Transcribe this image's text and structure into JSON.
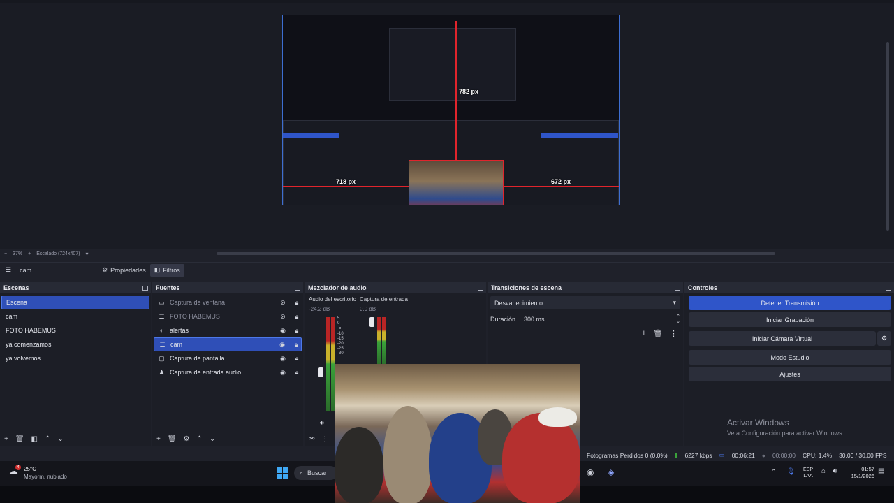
{
  "preview": {
    "guides": {
      "top": "782 px",
      "left": "718 px",
      "right": "672 px"
    },
    "status_zoom_minus": "−",
    "status_zoom_value": "37%",
    "status_zoom_plus": "+",
    "status_scale": "Escalado (724x407)"
  },
  "context_bar": {
    "source_name": "cam",
    "properties_label": "Propiedades",
    "filters_label": "Filtros"
  },
  "scenes": {
    "title": "Escenas",
    "items": [
      "Escena",
      "cam",
      "FOTO HABEMUS",
      "ya comenzamos",
      "ya volvemos"
    ],
    "selected_index": 0
  },
  "sources": {
    "title": "Fuentes",
    "items": [
      {
        "label": "Captura de ventana",
        "icon": "window-icon",
        "visible": false
      },
      {
        "label": "FOTO HABEMUS",
        "icon": "list-icon",
        "visible": false
      },
      {
        "label": "alertas",
        "icon": "globe-icon",
        "visible": true
      },
      {
        "label": "cam",
        "icon": "list-icon",
        "visible": true
      },
      {
        "label": "Captura de pantalla",
        "icon": "monitor-icon",
        "visible": true
      },
      {
        "label": "Captura de entrada audio",
        "icon": "mic-icon",
        "visible": true
      }
    ],
    "selected_index": 3
  },
  "mixer": {
    "title": "Mezclador de audio",
    "channels": [
      {
        "name": "Audio del escritorio",
        "db": "-24.2 dB"
      },
      {
        "name": "Captura de entrada",
        "db": "0.0 dB"
      }
    ],
    "scale": [
      "5",
      "0",
      "-5",
      "-10",
      "-15",
      "-20",
      "-25",
      "-30"
    ]
  },
  "transitions": {
    "title": "Transiciones de escena",
    "type": "Desvanecimiento",
    "duration_label": "Duración",
    "duration_value": "300 ms"
  },
  "controls": {
    "title": "Controles",
    "buttons": [
      "Detener Transmisión",
      "Iniciar Grabación",
      "Iniciar Cámara Virtual",
      "Modo Estudio",
      "Ajustes"
    ]
  },
  "watermark": {
    "line1": "Activar Windows",
    "line2": "Ve a Configuración para activar Windows."
  },
  "statusbar": {
    "dropped": "Fotogramas Perdidos 0 (0.0%)",
    "bitrate": "6227 kbps",
    "stream_time": "00:06:21",
    "rec_time": "00:00:00",
    "cpu": "CPU: 1.4%",
    "fps": "30.00 / 30.00 FPS"
  },
  "taskbar": {
    "weather_temp": "25°C",
    "weather_desc": "Mayorm. nublado",
    "weather_badge": "4",
    "search_placeholder": "Buscar",
    "lang_line1": "ESP",
    "lang_line2": "LAA",
    "time": "01:57",
    "date": "15/1/2026"
  },
  "colors": {
    "accent": "#2f55c9",
    "guide_red": "#e0242c",
    "panel_bg": "#1c1e26"
  }
}
